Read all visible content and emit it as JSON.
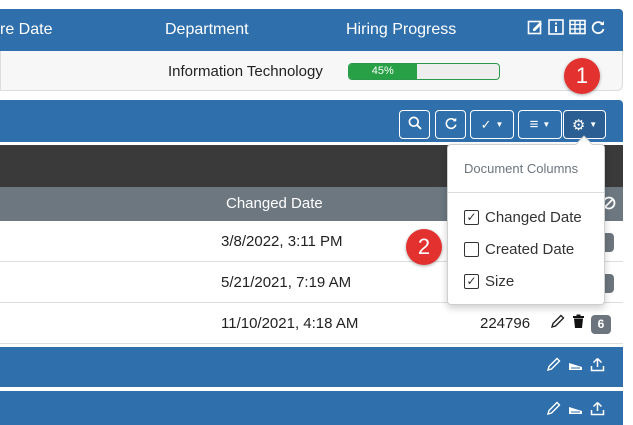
{
  "top_table": {
    "headers": [
      "re Date",
      "Department",
      "Hiring Progress"
    ],
    "row": {
      "department": "Information Technology",
      "progress_label": "45%",
      "progress_fraction": 0.45
    },
    "header_icons": [
      "edit-square-icon",
      "info-icon",
      "grid-icon",
      "refresh-icon"
    ]
  },
  "badges": {
    "first": "1",
    "second": "2"
  },
  "toolbar": {
    "buttons": [
      "search-icon",
      "refresh-icon",
      "check-dropdown",
      "list-dropdown",
      "gear-dropdown"
    ],
    "check_glyph": "✓",
    "list_glyph": "≡",
    "gear_glyph": "⚙"
  },
  "document_table": {
    "column_header": "Changed Date",
    "rows": [
      {
        "changed_date": "3/8/2022, 3:11 PM",
        "size": "",
        "count": ""
      },
      {
        "changed_date": "5/21/2021, 7:19 AM",
        "size": "",
        "count": ""
      },
      {
        "changed_date": "11/10/2021, 4:18 AM",
        "size": "224796",
        "count": "6"
      }
    ]
  },
  "dropdown": {
    "title": "Document Columns",
    "options": [
      {
        "label": "Changed Date",
        "checked": true
      },
      {
        "label": "Created Date",
        "checked": false
      },
      {
        "label": "Size",
        "checked": true
      }
    ]
  },
  "colors": {
    "header_blue": "#2f6fac",
    "progress_green": "#27a046",
    "badge_red": "#e2312f",
    "dark_bar": "#3a3a3a",
    "column_header_gray": "#6c7780"
  }
}
